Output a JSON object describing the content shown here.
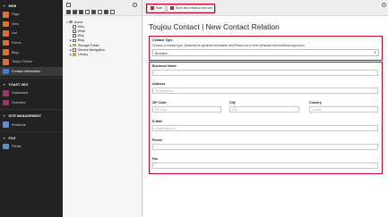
{
  "modules": [
    {
      "section": "WEB",
      "items": [
        {
          "label": "Page",
          "icon": "page-icon",
          "color": "#e36f2f"
        },
        {
          "label": "View",
          "icon": "view-icon",
          "color": "#e36f2f"
        },
        {
          "label": "List",
          "icon": "list-icon",
          "color": "#e36f2f"
        },
        {
          "label": "Forms",
          "icon": "forms-icon",
          "color": "#e36f2f"
        },
        {
          "label": "Blog",
          "icon": "blog-icon",
          "color": "#e36f2f"
        },
        {
          "label": "Toujou Theme",
          "icon": "theme-icon",
          "color": "#e36f2f"
        },
        {
          "label": "Contact Information",
          "icon": "contact-icon",
          "color": "#3c7fd1",
          "active": true
        }
      ]
    },
    {
      "section": "YOAST SEO",
      "items": [
        {
          "label": "Dashboard",
          "icon": "dashboard-icon",
          "color": "#a3346b"
        },
        {
          "label": "Overview",
          "icon": "overview-icon",
          "color": "#a3346b"
        }
      ]
    },
    {
      "section": "SITE MANAGEMENT",
      "items": [
        {
          "label": "Redirects",
          "icon": "redirects-icon",
          "color": "#5b8fd6"
        }
      ]
    },
    {
      "section": "FILE",
      "items": [
        {
          "label": "Filelist",
          "icon": "filelist-icon",
          "color": "#5b8fd6"
        }
      ]
    }
  ],
  "tree": [
    {
      "label": "Home",
      "level": 0,
      "type": "globe",
      "toggle": "▼"
    },
    {
      "label": "Who",
      "level": 1,
      "type": "page",
      "toggle": ""
    },
    {
      "label": "What",
      "level": 1,
      "type": "page",
      "toggle": ""
    },
    {
      "label": "Why",
      "level": 1,
      "type": "page",
      "toggle": ""
    },
    {
      "label": "Blog",
      "level": 1,
      "type": "page",
      "toggle": "▶"
    },
    {
      "label": "Storage Folder",
      "level": 1,
      "type": "folder",
      "toggle": "▶"
    },
    {
      "label": "Service-Navigation",
      "level": 1,
      "type": "page",
      "toggle": "▶"
    },
    {
      "label": "Library",
      "level": 1,
      "type": "folder",
      "toggle": "▶"
    }
  ],
  "header": {
    "save_label": "Save",
    "save_new_label": "Save and create a new one",
    "help": "?"
  },
  "page_title": "Toujou Contact | New Contact Relation",
  "contact_type": {
    "label": "Contact Type",
    "description": "Choose a contact type. Business for general information and Person for a more personal and individual approach.",
    "value": "Business"
  },
  "fields": {
    "business_name": {
      "label": "Business Name",
      "placeholder": ""
    },
    "address": {
      "label": "Address",
      "placeholder": "Street address"
    },
    "zip": {
      "label": "ZIP Code",
      "placeholder": "ZIP Code"
    },
    "city": {
      "label": "City",
      "placeholder": "City"
    },
    "country": {
      "label": "Country",
      "placeholder": "Country"
    },
    "email": {
      "label": "E-Mail",
      "placeholder": "you@email.com"
    },
    "phone": {
      "label": "Phone",
      "placeholder": ""
    },
    "fax": {
      "label": "Fax",
      "placeholder": ""
    }
  },
  "colors": {
    "accent": "#d0021b",
    "sidebar_bg": "#222222"
  }
}
